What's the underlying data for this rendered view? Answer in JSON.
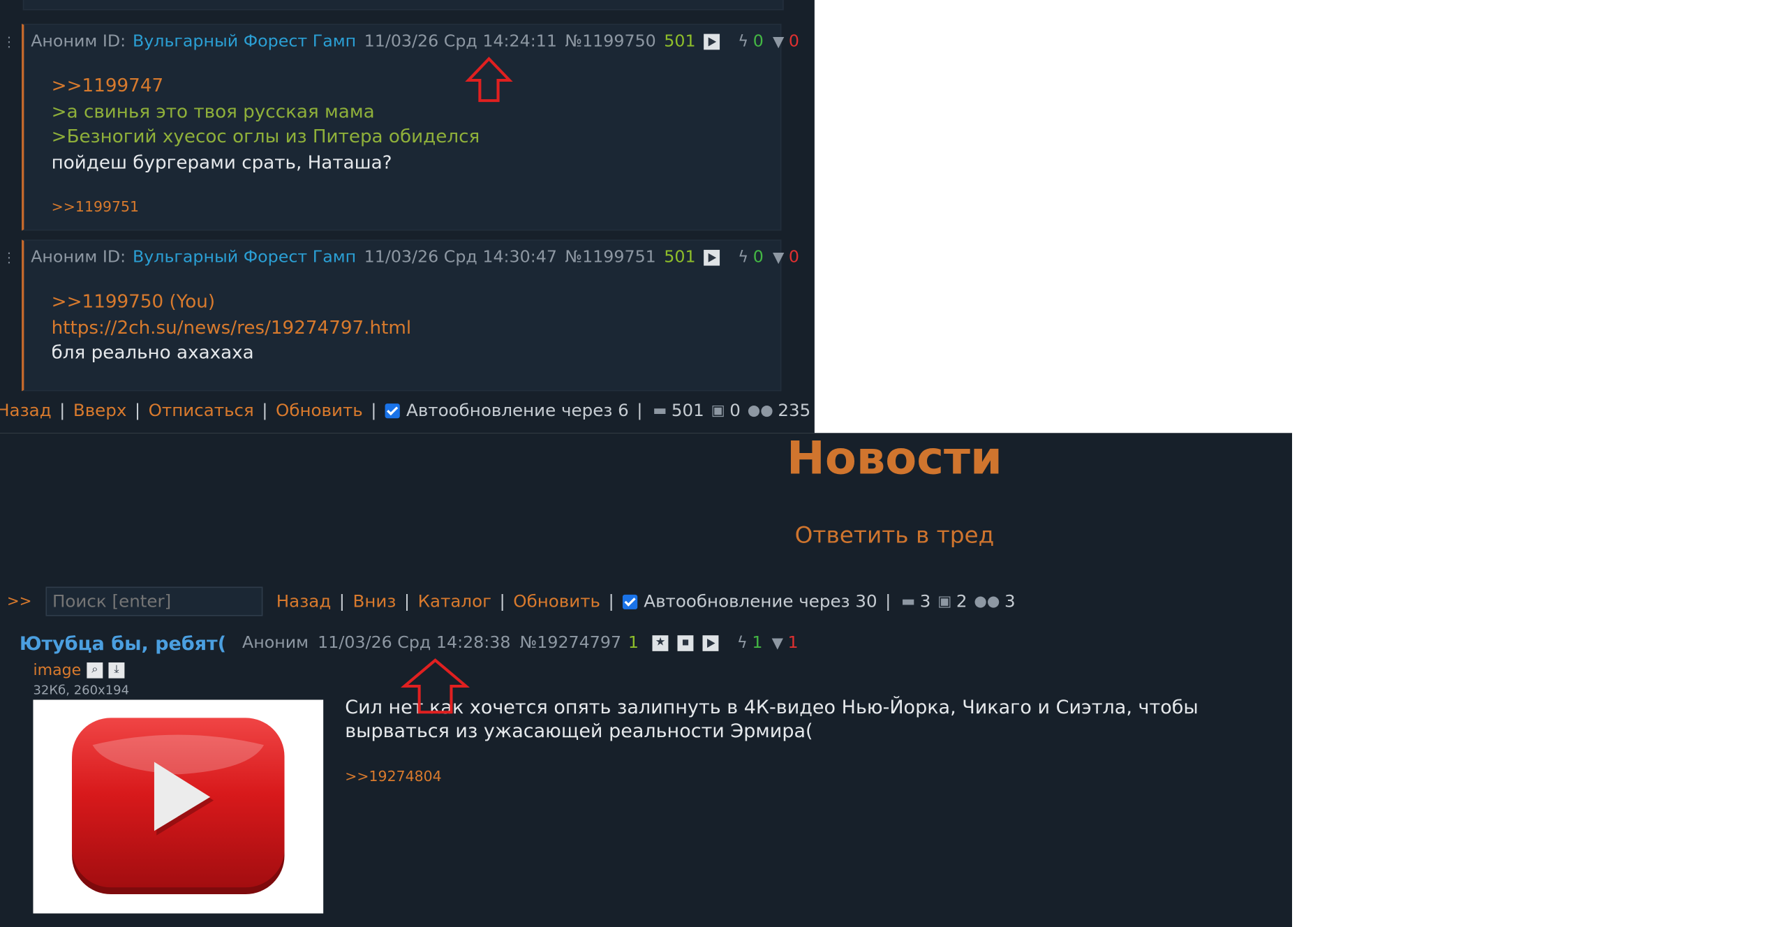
{
  "thread_top": {
    "posts": [
      {
        "author": "Аноним ID:",
        "id_name": "Вульгарный Форест Гамп",
        "date": "11/03/26 Срд 14:24:11",
        "number": "№1199750",
        "count": "501",
        "likes": "0",
        "dislikes": "0",
        "lines": [
          {
            "kind": "ref",
            "text": ">>1199747"
          },
          {
            "kind": "quote",
            "text": ">а свинья это твоя русская мама"
          },
          {
            "kind": "quote",
            "text": ">Безногий хуесос оглы из Питера обиделся"
          },
          {
            "kind": "text",
            "text": "пойдеш бургерами срать, Наташа?"
          }
        ],
        "replies": ">>1199751"
      },
      {
        "author": "Аноним ID:",
        "id_name": "Вульгарный Форест Гамп",
        "date": "11/03/26 Срд 14:30:47",
        "number": "№1199751",
        "count": "501",
        "likes": "0",
        "dislikes": "0",
        "lines": [
          {
            "kind": "ref",
            "text": ">>1199750 (You)"
          },
          {
            "kind": "link",
            "text": "https://2ch.su/news/res/19274797.html"
          },
          {
            "kind": "text",
            "text": "бля реально ахахаха"
          }
        ]
      }
    ],
    "nav": {
      "back": "Назад",
      "up": "Вверх",
      "unsubscribe": "Отписаться",
      "refresh": "Обновить",
      "autoupdate": "Автообновление через 6",
      "posts": "501",
      "images": "0",
      "users": "235"
    }
  },
  "board": {
    "title": "Новости",
    "reply_link": "Ответить в тред",
    "nav": {
      "arrows": ">>",
      "search_placeholder": "Поиск [enter]",
      "back": "Назад",
      "down": "Вниз",
      "catalog": "Каталог",
      "refresh": "Обновить",
      "autoupdate": "Автообновление через 30",
      "posts": "3",
      "images": "2",
      "users": "3"
    },
    "op": {
      "subject": "Ютубца бы, ребят(",
      "author": "Аноним",
      "date": "11/03/26 Срд 14:28:38",
      "number": "№19274797",
      "count": "1",
      "likes": "1",
      "dislikes": "1",
      "file_name": "image",
      "file_info": "32Кб, 260x194",
      "text": "Сил нет как хочется опять залипнуть в 4К-видео Нью-Йорка, Чикаго и Сиэтла, чтобы вырваться из ужасающей реальности Эрмира(",
      "replies": ">>19274804"
    }
  },
  "colors": {
    "background": "#17202a",
    "post_bg": "#1b2734",
    "accent": "#d97a2d",
    "quote": "#8fb03a",
    "id_name": "#2b9fd4",
    "subject": "#4b9fe0",
    "annotation": "#e02020"
  },
  "icons": [
    "play-icon",
    "lightning-icon",
    "thumbs-down-icon",
    "comment-icon",
    "image-icon",
    "users-icon",
    "star-icon",
    "magnify-icon",
    "download-icon",
    "checkbox-checked-icon",
    "youtube-logo"
  ]
}
